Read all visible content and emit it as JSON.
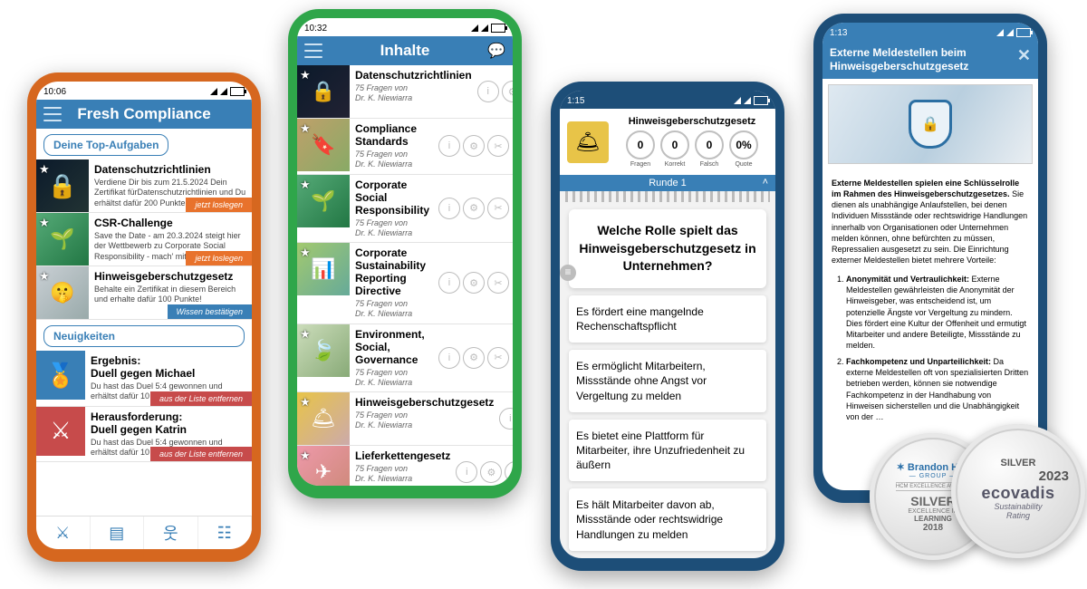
{
  "phone1": {
    "time": "10:06",
    "title": "Fresh Compliance",
    "section_top": "Deine Top-Aufgaben",
    "section_news": "Neuigkeiten",
    "tasks": [
      {
        "title": "Datenschutzrichtlinien",
        "sub": "Verdiene Dir bis zum 21.5.2024 Dein Zertifikat fürDatenschutzrichtlinien und Du erhältst dafür 200 Punkte!",
        "btn": "jetzt loslegen"
      },
      {
        "title": "CSR-Challenge",
        "sub": "Save the Date - am 20.3.2024 steigt hier der Wettbewerb zu Corporate Social Responsibility - mach' mit und verdiene …",
        "btn": "jetzt loslegen"
      },
      {
        "title": "Hinweisgeberschutzgesetz",
        "sub": "Behalte ein Zertifikat in diesem Bereich und erhalte dafür 100 Punkte!",
        "btn": "Wissen bestätigen"
      }
    ],
    "news": [
      {
        "title": "Ergebnis:\nDuell gegen Michael",
        "sub": "Du hast das Duel 5:4 gewonnen und erhältst dafür 10 Punkte.",
        "btn": "aus der Liste entfernen"
      },
      {
        "title": "Herausforderung:\nDuell gegen Katrin",
        "sub": "Du hast das Duel 5:4 gewonnen und erhältst dafür 10 Punkte.",
        "btn": "aus der Liste entfernen"
      }
    ]
  },
  "phone2": {
    "time": "10:32",
    "title": "Inhalte",
    "meta": "75 Fragen von\nDr. K. Niewiarra",
    "items": [
      "Datenschutzrichtlinien",
      "Compliance Standards",
      "Corporate Social Responsibility",
      "Corporate Sustainability Reporting Directive",
      "Environment, Social, Governance",
      "Hinweisgeberschutzgesetz",
      "Lieferkettengesetz"
    ]
  },
  "phone3": {
    "time": "1:15",
    "title": "Hinweisgeberschutzgesetz",
    "stats": {
      "fragen": "0",
      "korrekt": "0",
      "falsch": "0",
      "quote": "0%"
    },
    "stat_labels": {
      "fragen": "Fragen",
      "korrekt": "Korrekt",
      "falsch": "Falsch",
      "quote": "Quote"
    },
    "round": "Runde 1",
    "question": "Welche Rolle spielt das Hinweisgeberschutzgesetz in Unternehmen?",
    "answers": [
      "Es fördert eine mangelnde Rechenschaftspflicht",
      "Es ermöglicht Mitarbeitern, Missstände ohne Angst vor Vergeltung zu melden",
      "Es bietet eine Plattform für Mitarbeiter, ihre Unzufriedenheit zu äußern",
      "Es hält Mitarbeiter davon ab, Missstände oder rechtswidrige Handlungen zu melden"
    ]
  },
  "phone4": {
    "time": "1:13",
    "title": "Externe Meldestellen beim Hinweisgeberschutzgesetz",
    "lead_bold": "Externe Meldestellen spielen eine Schlüsselrolle im Rahmen des Hinweisgeberschutzgesetzes.",
    "lead_rest": " Sie dienen als unabhängige Anlaufstellen, bei denen Individuen Missstände oder rechtswidrige Handlungen innerhalb von Organisationen oder Unternehmen melden können, ohne befürchten zu müssen, Repressalien ausgesetzt zu sein. Die Einrichtung externer Meldestellen bietet mehrere Vorteile:",
    "points": [
      {
        "h": "Anonymität und Vertraulichkeit:",
        "b": "Externe Meldestellen gewährleisten die Anonymität der Hinweisgeber, was entscheidend ist, um potenzielle Ängste vor Vergeltung zu mindern. Dies fördert eine Kultur der Offenheit und ermutigt Mitarbeiter und andere Beteiligte, Missstände zu melden."
      },
      {
        "h": "Fachkompetenz und Unparteilichkeit:",
        "b": "Da externe Meldestellen oft von spezialisierten Dritten betrieben werden, können sie notwendige Fachkompetenz in der Handhabung von Hinweisen sicherstellen und die Unabhängigkeit von der …"
      }
    ]
  },
  "badges": {
    "bh_top": "Brandon Hall",
    "bh_group": "— GROUP —",
    "bh_sub": "HCM EXCELLENCE AWARDS",
    "bh_silver": "SILVER",
    "bh_line1": "EXCELLENCE IN",
    "bh_line2": "LEARNING",
    "bh_year": "2018",
    "ev_silver": "SILVER",
    "ev_year": "2023",
    "ev_brand": "ecovadis",
    "ev_sub": "Sustainability\nRating"
  }
}
